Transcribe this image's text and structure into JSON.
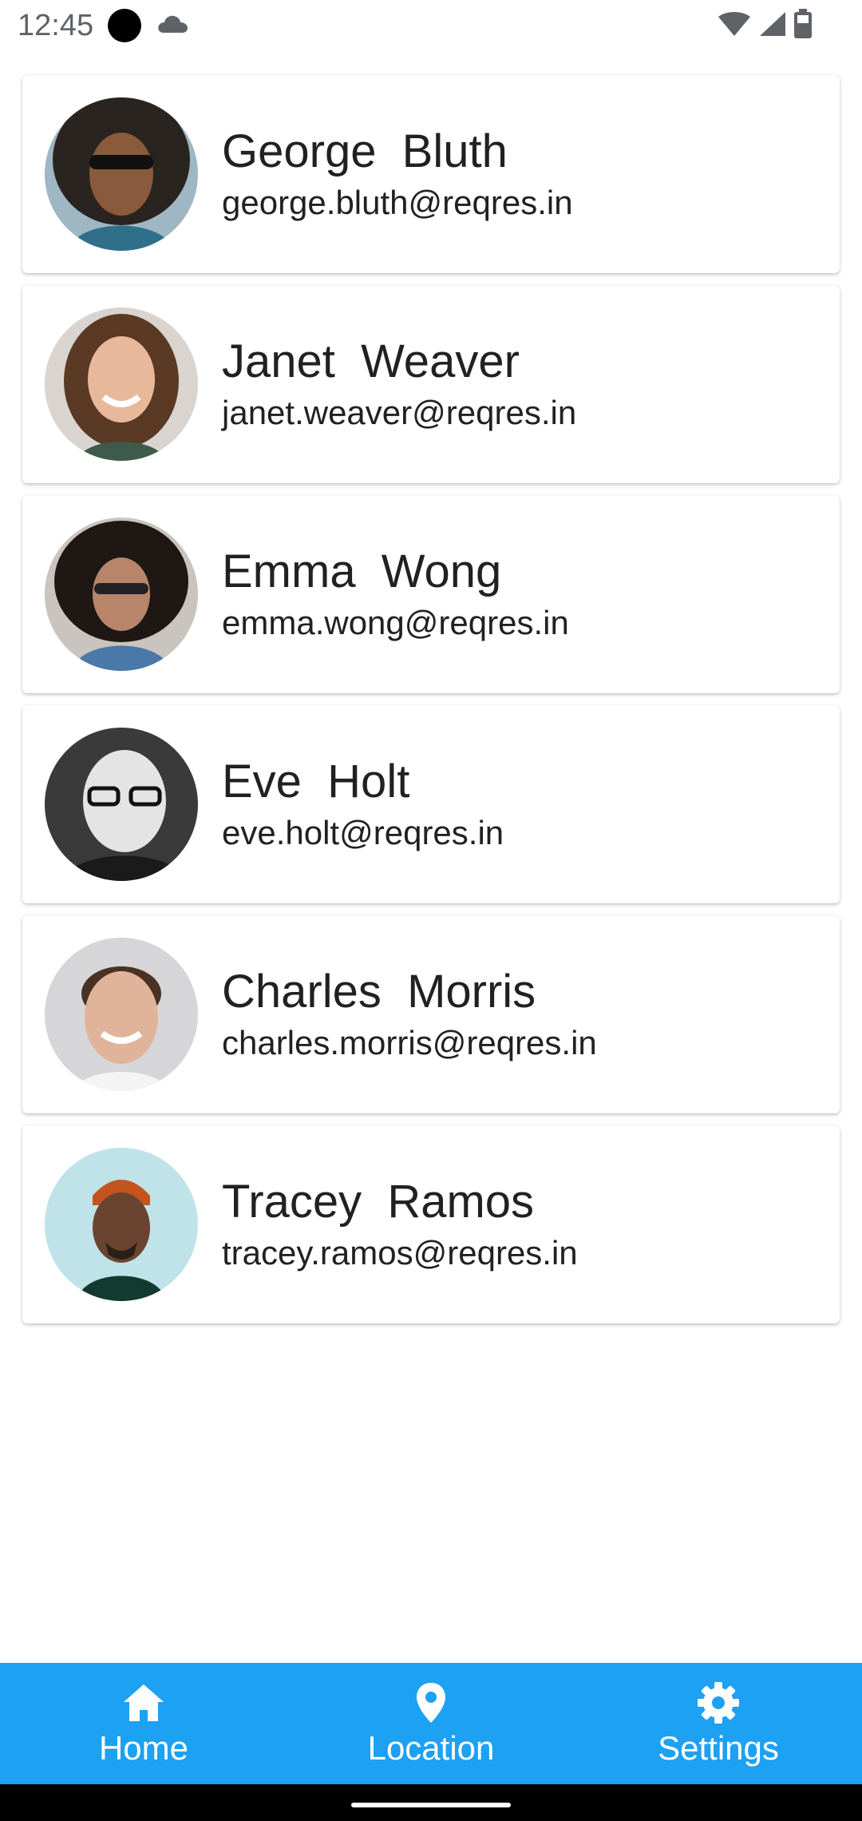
{
  "status_bar": {
    "time": "12:45"
  },
  "users": [
    {
      "name": "George  Bluth",
      "email": "george.bluth@reqres.in"
    },
    {
      "name": "Janet  Weaver",
      "email": "janet.weaver@reqres.in"
    },
    {
      "name": "Emma  Wong",
      "email": "emma.wong@reqres.in"
    },
    {
      "name": "Eve  Holt",
      "email": "eve.holt@reqres.in"
    },
    {
      "name": "Charles  Morris",
      "email": "charles.morris@reqres.in"
    },
    {
      "name": "Tracey  Ramos",
      "email": "tracey.ramos@reqres.in"
    }
  ],
  "bottom_nav": {
    "items": [
      {
        "label": "Home",
        "icon": "home-icon"
      },
      {
        "label": "Location",
        "icon": "location-pin-icon"
      },
      {
        "label": "Settings",
        "icon": "gear-icon"
      }
    ]
  },
  "colors": {
    "nav_background": "#1da1f2",
    "text_primary": "#212121"
  }
}
